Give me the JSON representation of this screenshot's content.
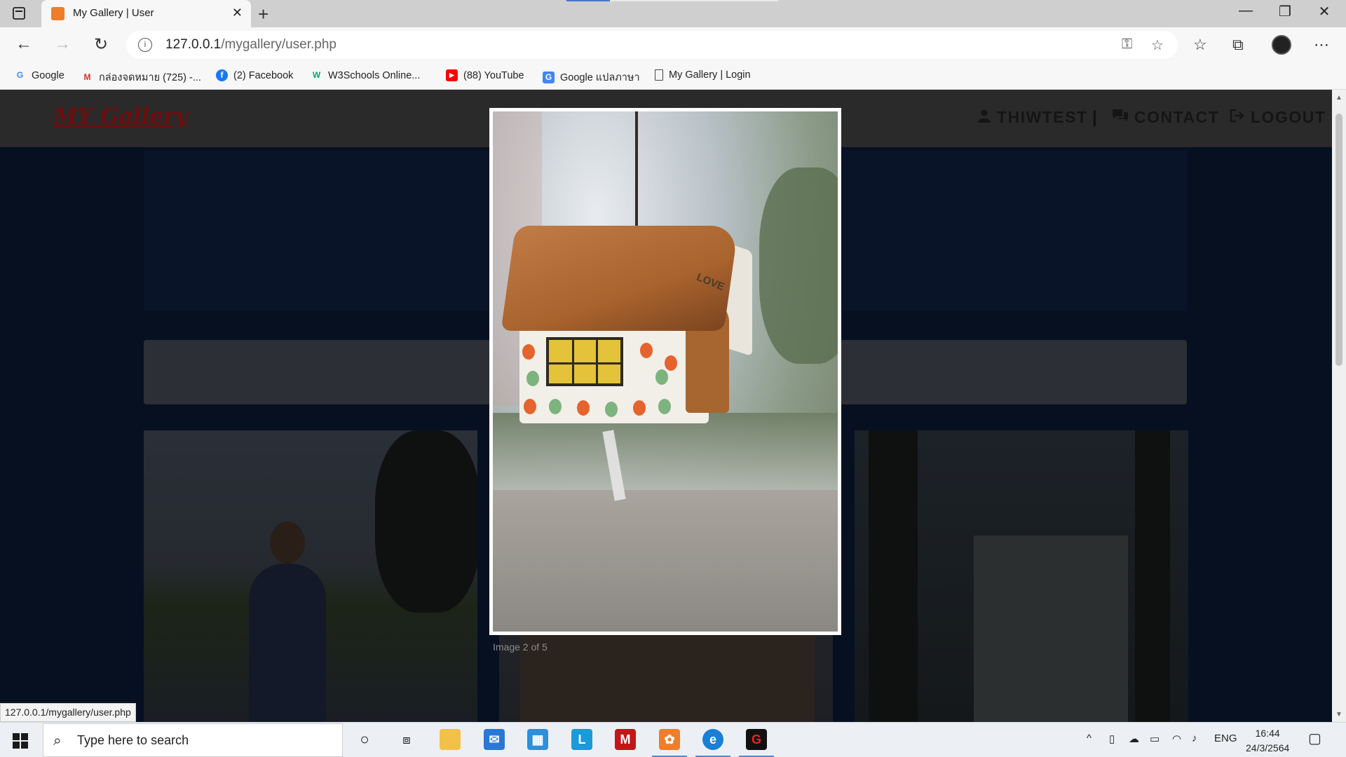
{
  "browser": {
    "tab_title": "My Gallery | User",
    "tab_close": "✕",
    "new_tab": "+",
    "url_host": "127.0.0.1",
    "url_path": "/mygallery/user.php",
    "window_controls": [
      "—",
      "❐",
      "✕"
    ],
    "bookmarks": [
      {
        "label": "Google",
        "icon": "google-icon",
        "color": "#4285f4",
        "glyph": "G"
      },
      {
        "label": "กล่องจดหมาย (725) -...",
        "icon": "gmail-icon",
        "color": "#d93025",
        "glyph": "M"
      },
      {
        "label": "(2) Facebook",
        "icon": "facebook-icon",
        "color": "#1877f2",
        "glyph": "f"
      },
      {
        "label": "W3Schools Online...",
        "icon": "w3schools-icon",
        "color": "#04aa6d",
        "glyph": "W"
      },
      {
        "label": "(88) YouTube",
        "icon": "youtube-icon",
        "color": "#ff0000",
        "glyph": "▶"
      },
      {
        "label": "Google แปลภาษา",
        "icon": "google-translate-icon",
        "color": "#4285f4",
        "glyph": "G"
      },
      {
        "label": "My Gallery | Login",
        "icon": "page-icon",
        "color": "#ffffff",
        "glyph": "▯"
      }
    ],
    "status_url": "127.0.0.1/mygallery/user.php"
  },
  "site": {
    "logo": "MY Gallery",
    "nav_user": "THIWTEST",
    "nav_sep": "|",
    "nav_contact": "CONTACT",
    "nav_logout": "LOGOUT"
  },
  "lightbox": {
    "caption": "Image 2 of 5",
    "current": 2,
    "total": 5,
    "photo_text": "LOVE"
  },
  "taskbar": {
    "search_placeholder": "Type here to search",
    "lang": "ENG",
    "time": "16:44",
    "date": "24/3/2564"
  },
  "colors": {
    "accent": "#4a8ad4",
    "logo": "#6e0e0e",
    "overlay_bg": "#061021"
  }
}
